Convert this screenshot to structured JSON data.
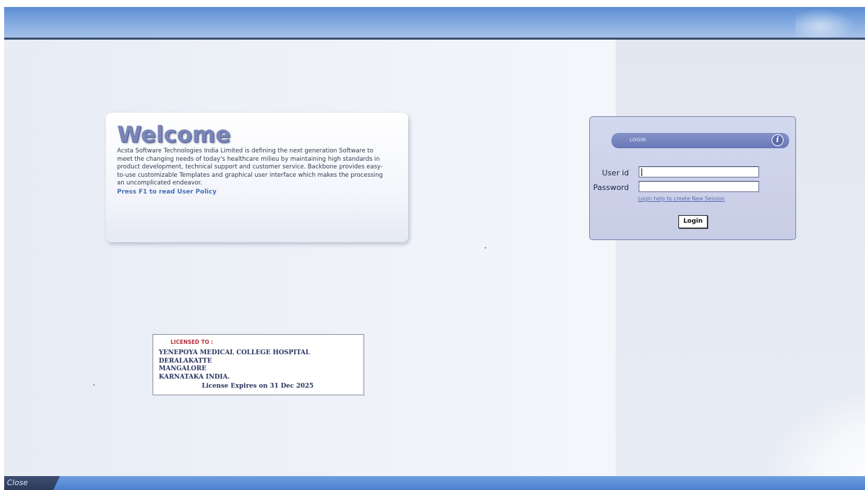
{
  "welcome": {
    "title": "Welcome",
    "body": "Acsta Software Technologies India Limited is defining the next generation Software to meet the changing needs of today's healthcare milieu by maintaining high standards in product development, technical support and customer service. Backbone provides easy-to-use customizable Templates and graphical user interface which makes the processing an uncomplicated endeavor.",
    "help_text": "Press F1 to read User Policy"
  },
  "license": {
    "header": "LICENSED TO :",
    "lines": [
      "YENEPOYA MEDICAL COLLEGE HOSPITAL",
      "DERALAKATTE",
      "MANGALORE",
      "KARNATAKA INDIA."
    ],
    "expiry": "License Expires on 31 Dec 2025"
  },
  "login": {
    "header_label": "LOGIN",
    "help_icon": "help-icon",
    "user_label": "User id",
    "user_value": "",
    "password_label": "Password",
    "password_value": "",
    "help_link": "Login help to create New Session",
    "button_label": "Login"
  },
  "bottom_bar": {
    "close_label": "Close"
  },
  "colors": {
    "banner": "#6d9be0",
    "panel": "#eef1f8",
    "login_box": "#cdd2ea",
    "accent": "#4a70b8"
  }
}
